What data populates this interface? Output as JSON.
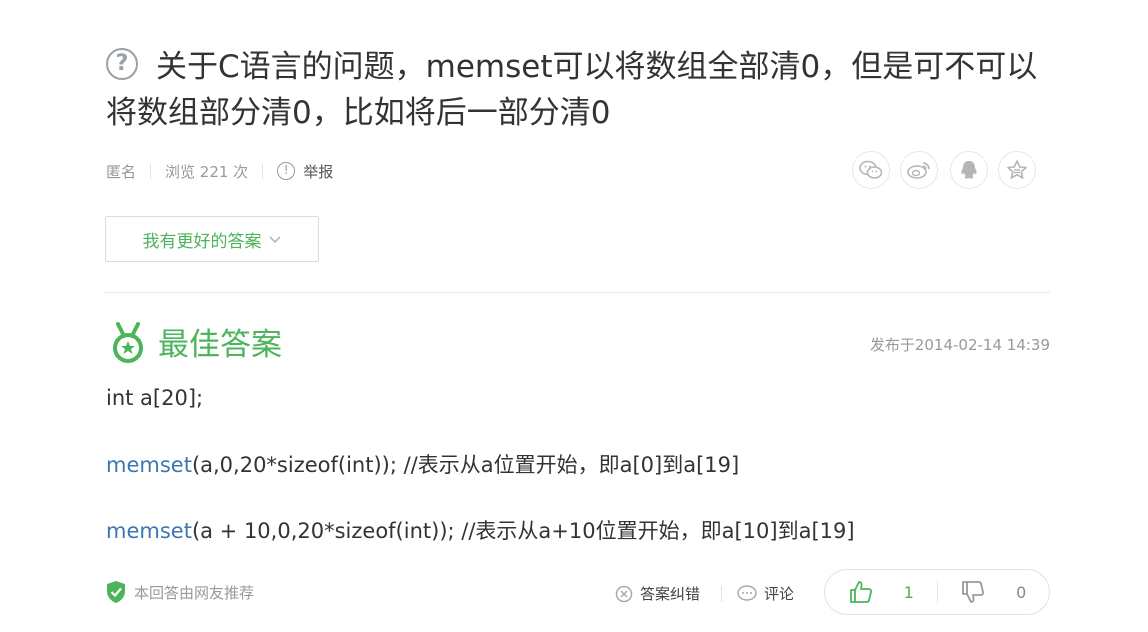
{
  "question": {
    "title": "关于C语言的问题，memset可以将数组全部清0，但是可不可以将数组部分清0，比如将后一部分清0",
    "help_icon": "question-circle-icon"
  },
  "meta": {
    "author": "匿名",
    "views": "浏览 221 次",
    "report": "举报"
  },
  "share": {
    "icons": [
      "wechat-icon",
      "weibo-icon",
      "qq-icon",
      "favorite-icon"
    ]
  },
  "better_answer_button": {
    "label": "我有更好的答案"
  },
  "best_answer": {
    "heading": "最佳答案",
    "published": "发布于2014-02-14 14:39",
    "lines": [
      {
        "kw": "",
        "text": "int a[20];"
      },
      {
        "kw": "memset",
        "text": "(a,0,20*sizeof(int)); //表示从a位置开始，即a[0]到a[19]"
      },
      {
        "kw": "memset",
        "text": "(a + 10,0,20*sizeof(int)); //表示从a+10位置开始，即a[10]到a[19]"
      }
    ],
    "recommend_text": "本回答由网友推荐",
    "actions": {
      "correct": "答案纠错",
      "comment": "评论"
    },
    "votes": {
      "up": "1",
      "down": "0"
    }
  },
  "colors": {
    "accent_green": "#4cb45b",
    "code_keyword": "#3c76b3",
    "muted": "#999999"
  }
}
